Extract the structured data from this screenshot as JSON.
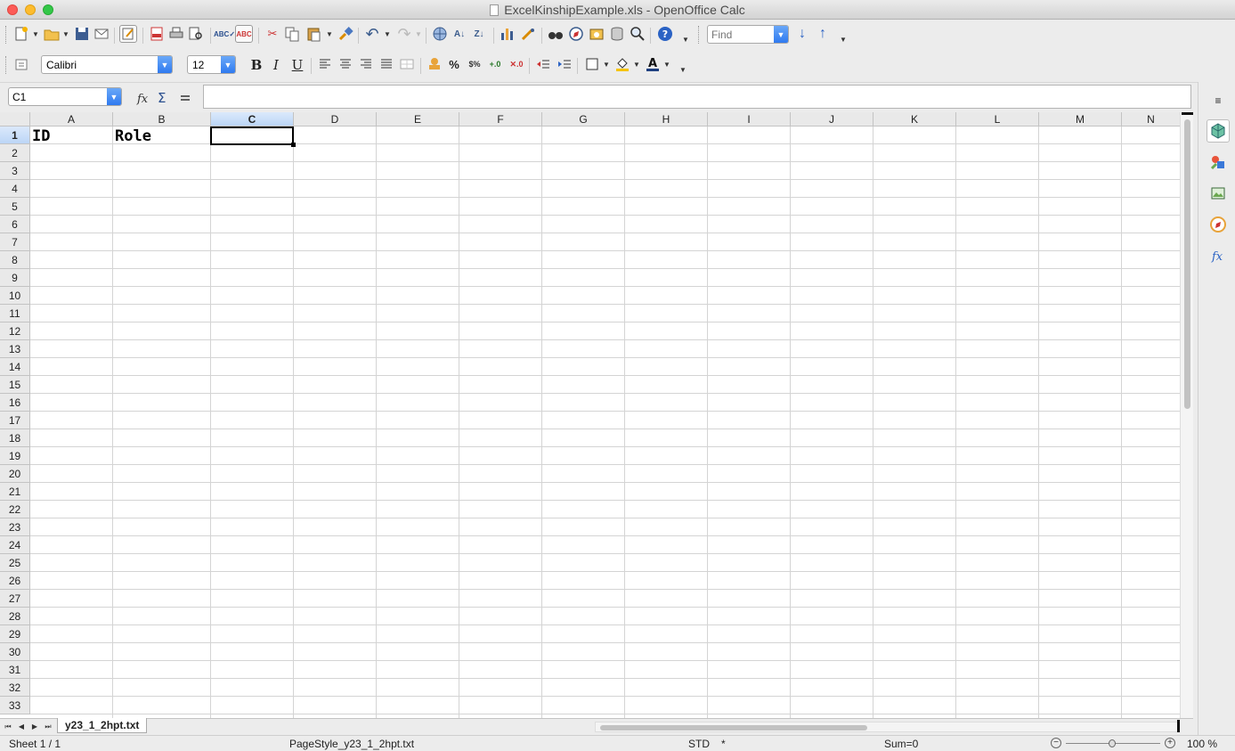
{
  "window": {
    "title": "ExcelKinshipExample.xls - OpenOffice Calc"
  },
  "toolbar": {
    "find_placeholder": "Find"
  },
  "formatting": {
    "font_name": "Calibri",
    "font_size": "12",
    "bold_label": "B",
    "italic_label": "I",
    "underline_label": "U",
    "percent_label": "%"
  },
  "formula_bar": {
    "name_box": "C1",
    "content": ""
  },
  "sheet": {
    "columns": [
      "A",
      "B",
      "C",
      "D",
      "E",
      "F",
      "G",
      "H",
      "I",
      "J",
      "K",
      "L",
      "M",
      "N"
    ],
    "selected_column": "C",
    "rows": [
      "1",
      "2",
      "3",
      "4",
      "5",
      "6",
      "7",
      "8",
      "9",
      "10",
      "11",
      "12",
      "13",
      "14",
      "15",
      "16",
      "17",
      "18",
      "19",
      "20",
      "21",
      "22",
      "23",
      "24",
      "25",
      "26",
      "27",
      "28",
      "29",
      "30",
      "31",
      "32",
      "33"
    ],
    "selected_row": "1",
    "cells": {
      "A1": "ID",
      "B1": "Role"
    },
    "active_cell": "C1"
  },
  "tabs": {
    "sheet_name": "y23_1_2hpt.txt"
  },
  "statusbar": {
    "sheet_position": "Sheet 1 / 1",
    "page_style": "PageStyle_y23_1_2hpt.txt",
    "mode": "STD",
    "modified": "*",
    "sum": "Sum=0",
    "zoom": "100 %"
  }
}
